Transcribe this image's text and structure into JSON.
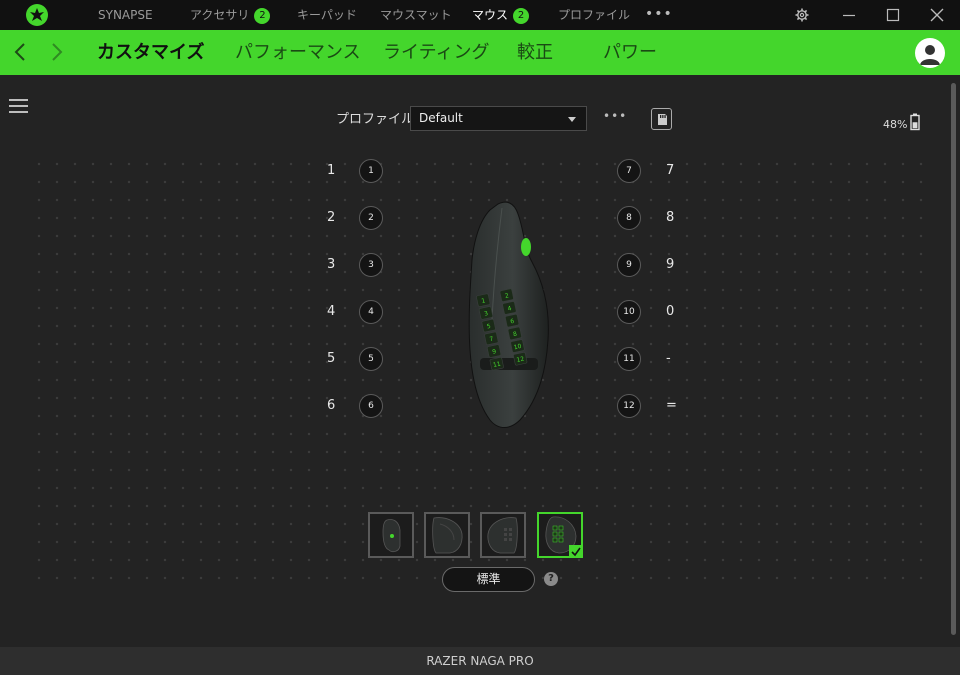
{
  "titlebar": {
    "nav": [
      {
        "label": "SYNAPSE",
        "badge": null
      },
      {
        "label": "アクセサリ",
        "badge": "2"
      },
      {
        "label": "キーパッド",
        "badge": null
      },
      {
        "label": "マウスマット",
        "badge": null
      },
      {
        "label": "マウス",
        "badge": "2"
      },
      {
        "label": "プロファイル",
        "badge": null
      }
    ],
    "more": "•••"
  },
  "tabs": {
    "items": [
      "カスタマイズ",
      "パフォーマンス",
      "ライティング",
      "較正",
      "パワー"
    ],
    "active": "カスタマイズ"
  },
  "profile": {
    "label": "プロファイル",
    "selected": "Default",
    "more": "•••"
  },
  "battery": {
    "level_text": "48%",
    "level": 0.48
  },
  "buttons": {
    "left": [
      {
        "num": "1",
        "mapping": "1"
      },
      {
        "num": "2",
        "mapping": "2"
      },
      {
        "num": "3",
        "mapping": "3"
      },
      {
        "num": "4",
        "mapping": "4"
      },
      {
        "num": "5",
        "mapping": "5"
      },
      {
        "num": "6",
        "mapping": "6"
      }
    ],
    "right": [
      {
        "num": "7",
        "mapping": "7"
      },
      {
        "num": "8",
        "mapping": "8"
      },
      {
        "num": "9",
        "mapping": "9"
      },
      {
        "num": "10",
        "mapping": "0"
      },
      {
        "num": "11",
        "mapping": "-"
      },
      {
        "num": "12",
        "mapping": "="
      }
    ]
  },
  "views": {
    "selected_index": 3,
    "standard_label": "標準",
    "help": "?"
  },
  "footer": {
    "device_name": "RAZER NAGA PRO"
  },
  "colors": {
    "accent": "#44d62c",
    "background": "#232323",
    "titlebar": "#111111"
  }
}
